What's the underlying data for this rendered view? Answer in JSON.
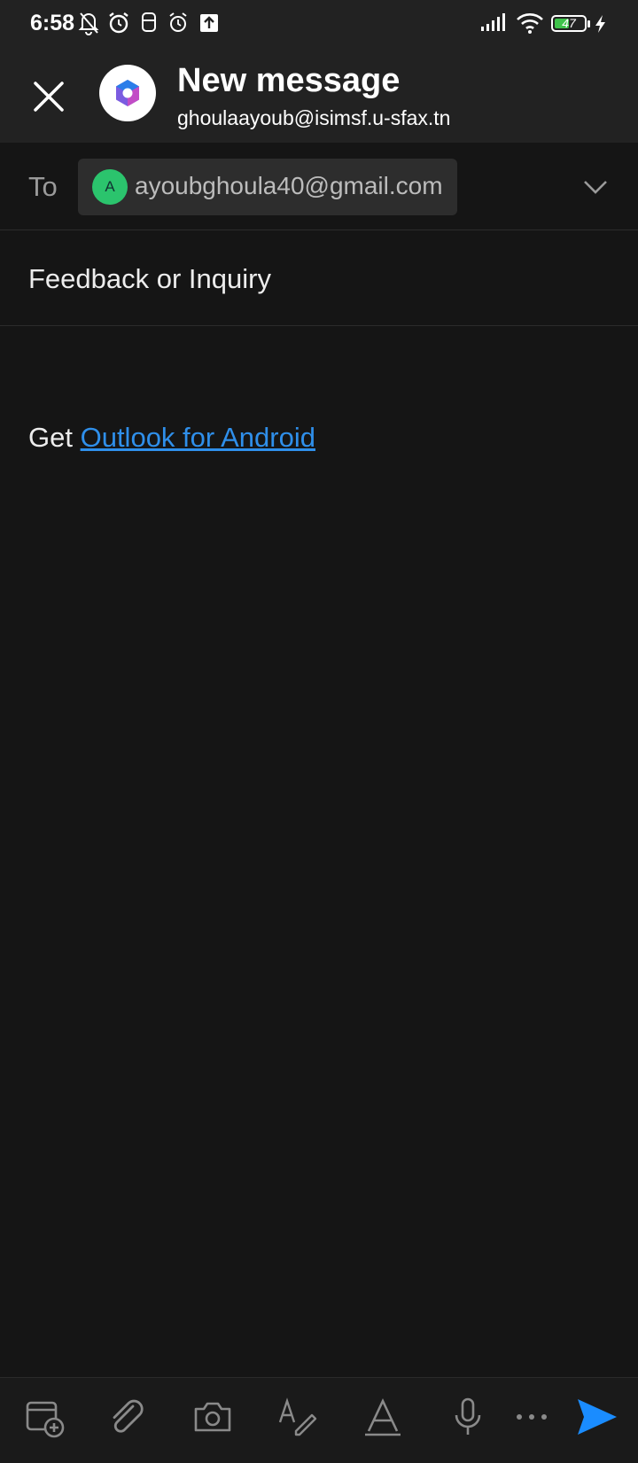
{
  "status_bar": {
    "time": "6:58",
    "icons": [
      "bell-off-icon",
      "alarm-icon",
      "sim-icon",
      "alarm-icon",
      "upload-icon",
      "signal-icon",
      "wifi-icon",
      "battery-icon",
      "charging-icon"
    ],
    "battery_level": "47"
  },
  "app_bar": {
    "title": "New message",
    "account": "ghoulaayoub@isimsf.u-sfax.tn"
  },
  "recipients": {
    "label": "To",
    "to": [
      {
        "initial": "A",
        "email": "ayoubghoula40@gmail.com",
        "avatar_color": "#2bc46d"
      }
    ]
  },
  "subject": "Feedback or Inquiry",
  "body": {
    "prefix": "Get",
    "link_text": "Outlook for Android"
  },
  "toolbar": {
    "buttons": [
      "add-event-icon",
      "attachment-icon",
      "camera-icon",
      "draw-icon",
      "format-text-icon",
      "microphone-icon",
      "more-icon",
      "send-icon"
    ]
  },
  "colors": {
    "background": "#151515",
    "header": "#222222",
    "accent": "#2f8fea",
    "send": "#1a8cff"
  }
}
